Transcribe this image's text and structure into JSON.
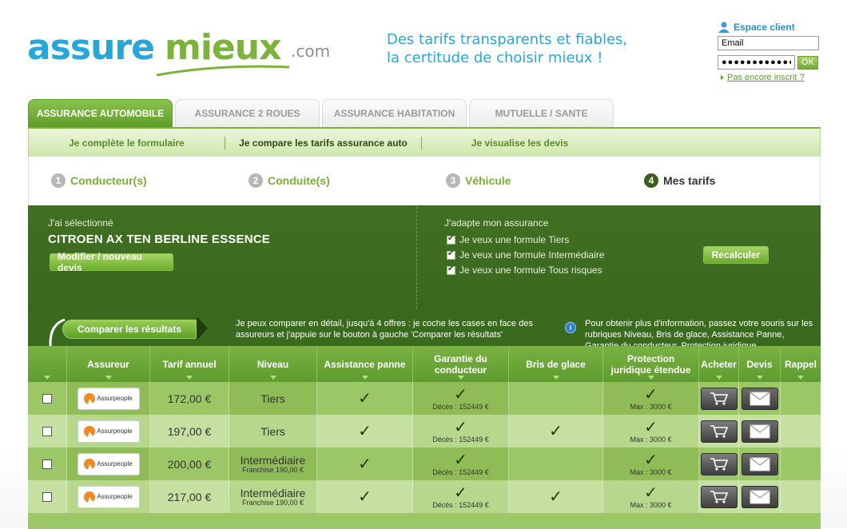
{
  "header": {
    "logo_part1": "assure",
    "logo_part2": "mieux",
    "logo_suffix": ".com",
    "tagline_line1": "Des tarifs transparents et fiables,",
    "tagline_line2": "la certitude de choisir mieux !"
  },
  "login": {
    "title": "Espace client",
    "email_value": "Email",
    "password_value": "●●●●●●●●●●●●●",
    "ok_label": "OK",
    "register_link": "Pas encore inscrit ?"
  },
  "tabs": [
    {
      "label": "ASSURANCE AUTOMOBILE",
      "active": true
    },
    {
      "label": "ASSURANCE 2 ROUES",
      "active": false
    },
    {
      "label": "ASSURANCE HABITATION",
      "active": false
    },
    {
      "label": "MUTUELLE / SANTE",
      "active": false
    }
  ],
  "subnav": [
    {
      "label": "Je complète le formulaire"
    },
    {
      "label": "Je compare les tarifs assurance auto"
    },
    {
      "label": "Je visualise les devis"
    }
  ],
  "steps": [
    {
      "num": "1",
      "label": "Conducteur(s)"
    },
    {
      "num": "2",
      "label": "Conduite(s)"
    },
    {
      "num": "3",
      "label": "Véhicule"
    },
    {
      "num": "4",
      "label": "Mes tarifs"
    }
  ],
  "selection": {
    "label": "J'ai sélectionné",
    "car": "CITROEN AX TEN BERLINE ESSENCE",
    "modify_button": "Modifier / nouveau devis"
  },
  "adapt": {
    "label": "J'adapte mon assurance",
    "formulas": [
      {
        "label": "Je veux une formule Tiers",
        "checked": true
      },
      {
        "label": "Je veux une formule Intermédiaire",
        "checked": true
      },
      {
        "label": "Je veux une formule Tous risques",
        "checked": true
      }
    ],
    "recalc_button": "Recalculer"
  },
  "compare": {
    "button": "Comparer les résultats",
    "text1": "Je peux comparer en détail, jusqu'à 4 offres : je coche les cases en face des assureurs et j'appuie sur le bouton à gauche 'Comparer les résultats'",
    "info_icon": "i",
    "text2": "Pour obtenir plus d'information, passez votre souris sur les rubriques Niveau, Bris de glace, Assistance Panne, Garantie du conducteur, Protection juridique …"
  },
  "table": {
    "headers": {
      "assureur": "Assureur",
      "tarif": "Tarif annuel",
      "niveau": "Niveau",
      "assistance": "Assistance panne",
      "garantie": "Garantie du conducteur",
      "bris": "Bris de glace",
      "protection": "Protection juridique étendue",
      "acheter": "Acheter",
      "devis": "Devis",
      "rappel": "Rappel"
    },
    "rows": [
      {
        "insurer": "Assurpeople",
        "price": "172,00 €",
        "level": "Tiers",
        "level_sub": "",
        "assistance": "✓",
        "garantie": "✓",
        "garantie_sub": "Décès : 152449 €",
        "bris": "",
        "protection": "✓",
        "protection_sub": "Max : 3000 €"
      },
      {
        "insurer": "Assurpeople",
        "price": "197,00 €",
        "level": "Tiers",
        "level_sub": "",
        "assistance": "✓",
        "garantie": "✓",
        "garantie_sub": "Décès : 152449 €",
        "bris": "✓",
        "protection": "✓",
        "protection_sub": "Max : 3000 €"
      },
      {
        "insurer": "Assurpeople",
        "price": "200,00 €",
        "level": "Intermédiaire",
        "level_sub": "Franchise 190,00 €",
        "assistance": "✓",
        "garantie": "✓",
        "garantie_sub": "Décès : 152449 €",
        "bris": "",
        "protection": "✓",
        "protection_sub": "Max : 3000 €"
      },
      {
        "insurer": "Assurpeople",
        "price": "217,00 €",
        "level": "Intermédiaire",
        "level_sub": "Franchise 190,00 €",
        "assistance": "✓",
        "garantie": "✓",
        "garantie_sub": "Décès : 152449 €",
        "bris": "✓",
        "protection": "✓",
        "protection_sub": "Max : 3000 €"
      }
    ]
  }
}
